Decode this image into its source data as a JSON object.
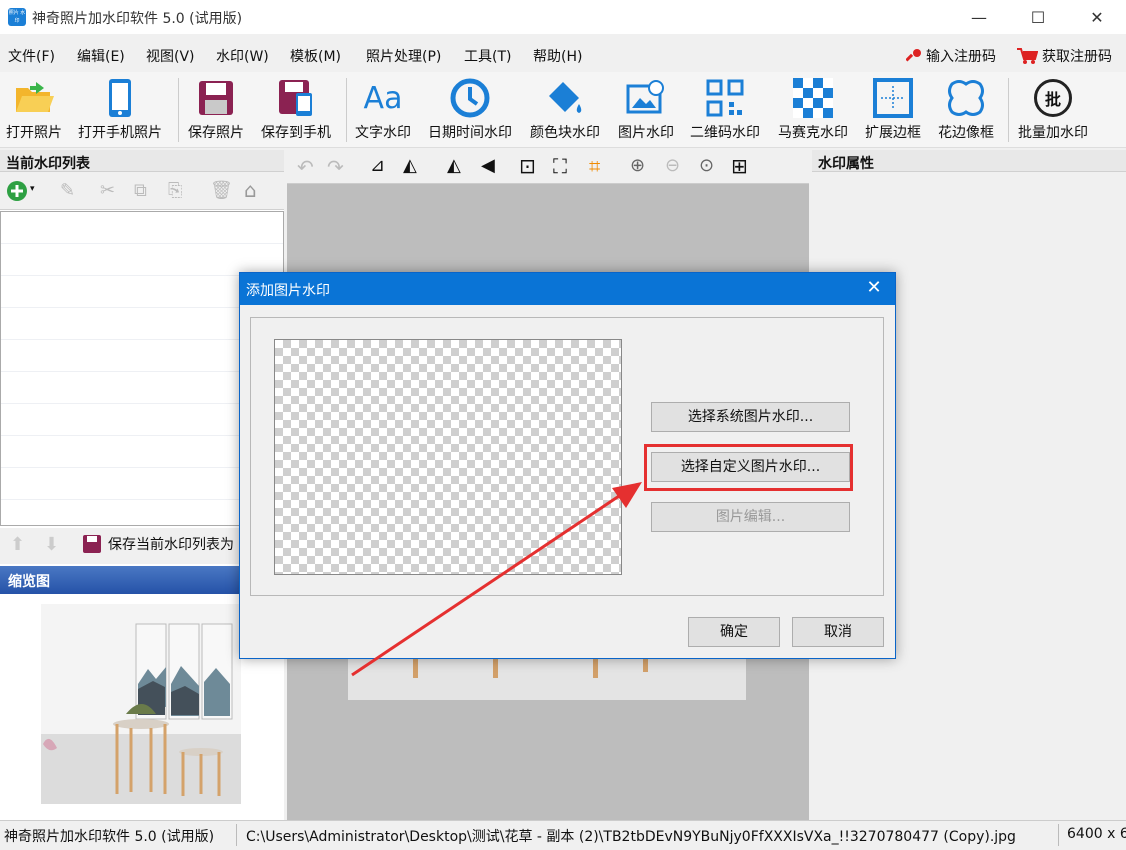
{
  "window": {
    "title": "神奇照片加水印软件 5.0 (试用版)",
    "icon_text": "照片 水印",
    "minimize": "—",
    "maximize": "☐",
    "close": "✕"
  },
  "menu": [
    "文件(F)",
    "编辑(E)",
    "视图(V)",
    "水印(W)",
    "模板(M)",
    "照片处理(P)",
    "工具(T)",
    "帮助(H)"
  ],
  "register": {
    "enter": "输入注册码",
    "get": "获取注册码"
  },
  "toolbar": [
    {
      "label": "打开照片",
      "icon": "folder-open-icon"
    },
    {
      "label": "打开手机照片",
      "icon": "phone-icon"
    },
    {
      "label": "保存照片",
      "icon": "save-icon"
    },
    {
      "label": "保存到手机",
      "icon": "save-phone-icon"
    },
    {
      "label": "文字水印",
      "icon": "text-aa-icon",
      "glyph": "Aa"
    },
    {
      "label": "日期时间水印",
      "icon": "clock-icon"
    },
    {
      "label": "颜色块水印",
      "icon": "paint-bucket-icon"
    },
    {
      "label": "图片水印",
      "icon": "image-watermark-icon"
    },
    {
      "label": "二维码水印",
      "icon": "qr-code-icon"
    },
    {
      "label": "马赛克水印",
      "icon": "mosaic-icon"
    },
    {
      "label": "扩展边框",
      "icon": "expand-border-icon"
    },
    {
      "label": "花边像框",
      "icon": "lace-frame-icon"
    },
    {
      "label": "批量加水印",
      "icon": "batch-icon",
      "glyph": "批"
    }
  ],
  "left": {
    "list_title": "当前水印列表",
    "save_label": "保存当前水印列表为",
    "thumb_title": "缩览图"
  },
  "right": {
    "title": "水印属性"
  },
  "status": {
    "app": "神奇照片加水印软件 5.0 (试用版)",
    "path": "C:\\Users\\Administrator\\Desktop\\测试\\花草 - 副本 (2)\\TB2tbDEvN9YBuNjy0FfXXXIsVXa_!!3270780477 (Copy).jpg",
    "size": "6400 x 6"
  },
  "dialog": {
    "title": "添加图片水印",
    "btn_system": "选择系统图片水印...",
    "btn_custom": "选择自定义图片水印...",
    "btn_edit": "图片编辑...",
    "ok": "确定",
    "cancel": "取消",
    "close": "✕"
  },
  "colors": {
    "accent": "#0a74d6",
    "highlight": "#e53030"
  }
}
